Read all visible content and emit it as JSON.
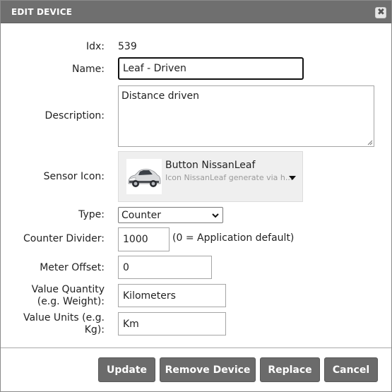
{
  "dialog": {
    "title": "EDIT DEVICE",
    "close_glyph": "✖"
  },
  "fields": {
    "idx": {
      "label": "Idx:",
      "value": "539"
    },
    "name": {
      "label": "Name:",
      "value": "Leaf - Driven"
    },
    "description": {
      "label": "Description:",
      "value": "Distance driven"
    },
    "sensor_icon": {
      "label": "Sensor Icon:",
      "title": "Button NissanLeaf",
      "description": "Icon NissanLeaf generate via h...",
      "icon": "car-icon"
    },
    "type": {
      "label": "Type:",
      "value": "Counter"
    },
    "counter_divider": {
      "label": "Counter Divider:",
      "value": "1000",
      "hint": "(0 = Application default)"
    },
    "meter_offset": {
      "label": "Meter Offset:",
      "value": "0"
    },
    "value_quantity": {
      "label_line1": "Value Quantity",
      "label_line2": "(e.g. Weight):",
      "value": "Kilometers"
    },
    "value_units": {
      "label_line1": "Value Units (e.g.",
      "label_line2": "Kg):",
      "value": "Km"
    }
  },
  "buttons": {
    "update": "Update",
    "remove": "Remove Device",
    "replace": "Replace",
    "cancel": "Cancel"
  },
  "colors": {
    "titlebar": "#6f6f6f",
    "button": "#6b6b6b",
    "icon_panel": "#efefef"
  }
}
